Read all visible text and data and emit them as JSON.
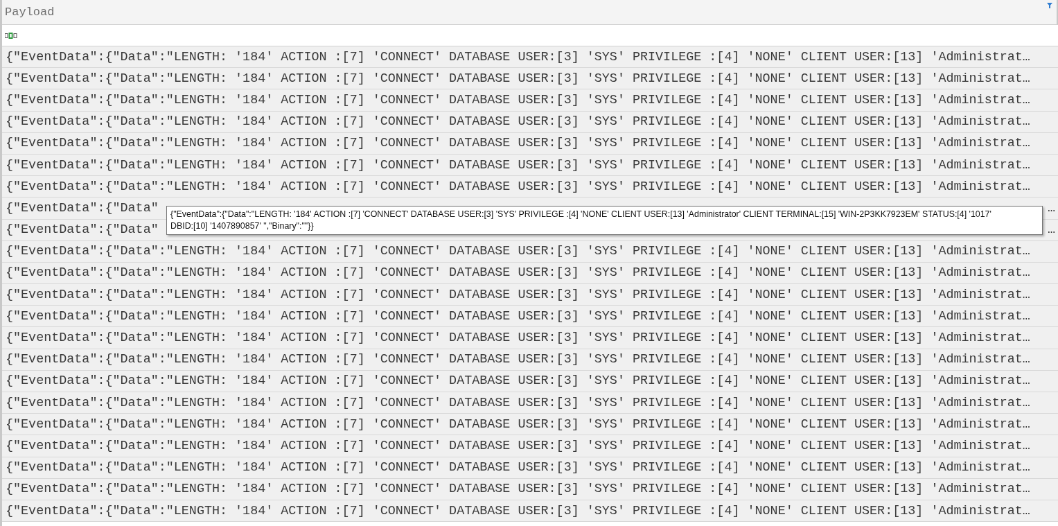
{
  "column": {
    "header": "Payload",
    "filter_active": true
  },
  "rows": [
    {
      "text": "{\"EventData\":{\"Data\":\"LENGTH: '184' ACTION :[7] 'CONNECT' DATABASE USER:[3] 'SYS' PRIVILEGE :[4] 'NONE' CLIENT USER:[13] 'Administrat…"
    },
    {
      "text": "{\"EventData\":{\"Data\":\"LENGTH: '184' ACTION :[7] 'CONNECT' DATABASE USER:[3] 'SYS' PRIVILEGE :[4] 'NONE' CLIENT USER:[13] 'Administrat…"
    },
    {
      "text": "{\"EventData\":{\"Data\":\"LENGTH: '184' ACTION :[7] 'CONNECT' DATABASE USER:[3] 'SYS' PRIVILEGE :[4] 'NONE' CLIENT USER:[13] 'Administrat…"
    },
    {
      "text": "{\"EventData\":{\"Data\":\"LENGTH: '184' ACTION :[7] 'CONNECT' DATABASE USER:[3] 'SYS' PRIVILEGE :[4] 'NONE' CLIENT USER:[13] 'Administrat…"
    },
    {
      "text": "{\"EventData\":{\"Data\":\"LENGTH: '184' ACTION :[7] 'CONNECT' DATABASE USER:[3] 'SYS' PRIVILEGE :[4] 'NONE' CLIENT USER:[13] 'Administrat…"
    },
    {
      "text": "{\"EventData\":{\"Data\":\"LENGTH: '184' ACTION :[7] 'CONNECT' DATABASE USER:[3] 'SYS' PRIVILEGE :[4] 'NONE' CLIENT USER:[13] 'Administrat…"
    },
    {
      "text": "{\"EventData\":{\"Data\":\"LENGTH: '184' ACTION :[7] 'CONNECT' DATABASE USER:[3] 'SYS' PRIVILEGE :[4] 'NONE' CLIENT USER:[13] 'Administrat…"
    },
    {
      "text": "{\"EventData\":{\"Data\"",
      "tail": "…"
    },
    {
      "text": "{\"EventData\":{\"Data\"",
      "tail": "…"
    },
    {
      "text": "{\"EventData\":{\"Data\":\"LENGTH: '184' ACTION :[7] 'CONNECT' DATABASE USER:[3] 'SYS' PRIVILEGE :[4] 'NONE' CLIENT USER:[13] 'Administrat…"
    },
    {
      "text": "{\"EventData\":{\"Data\":\"LENGTH: '184' ACTION :[7] 'CONNECT' DATABASE USER:[3] 'SYS' PRIVILEGE :[4] 'NONE' CLIENT USER:[13] 'Administrat…"
    },
    {
      "text": "{\"EventData\":{\"Data\":\"LENGTH: '184' ACTION :[7] 'CONNECT' DATABASE USER:[3] 'SYS' PRIVILEGE :[4] 'NONE' CLIENT USER:[13] 'Administrat…"
    },
    {
      "text": "{\"EventData\":{\"Data\":\"LENGTH: '184' ACTION :[7] 'CONNECT' DATABASE USER:[3] 'SYS' PRIVILEGE :[4] 'NONE' CLIENT USER:[13] 'Administrat…"
    },
    {
      "text": "{\"EventData\":{\"Data\":\"LENGTH: '184' ACTION :[7] 'CONNECT' DATABASE USER:[3] 'SYS' PRIVILEGE :[4] 'NONE' CLIENT USER:[13] 'Administrat…"
    },
    {
      "text": "{\"EventData\":{\"Data\":\"LENGTH: '184' ACTION :[7] 'CONNECT' DATABASE USER:[3] 'SYS' PRIVILEGE :[4] 'NONE' CLIENT USER:[13] 'Administrat…"
    },
    {
      "text": "{\"EventData\":{\"Data\":\"LENGTH: '184' ACTION :[7] 'CONNECT' DATABASE USER:[3] 'SYS' PRIVILEGE :[4] 'NONE' CLIENT USER:[13] 'Administrat…"
    },
    {
      "text": "{\"EventData\":{\"Data\":\"LENGTH: '184' ACTION :[7] 'CONNECT' DATABASE USER:[3] 'SYS' PRIVILEGE :[4] 'NONE' CLIENT USER:[13] 'Administrat…"
    },
    {
      "text": "{\"EventData\":{\"Data\":\"LENGTH: '184' ACTION :[7] 'CONNECT' DATABASE USER:[3] 'SYS' PRIVILEGE :[4] 'NONE' CLIENT USER:[13] 'Administrat…"
    },
    {
      "text": "{\"EventData\":{\"Data\":\"LENGTH: '184' ACTION :[7] 'CONNECT' DATABASE USER:[3] 'SYS' PRIVILEGE :[4] 'NONE' CLIENT USER:[13] 'Administrat…"
    },
    {
      "text": "{\"EventData\":{\"Data\":\"LENGTH: '184' ACTION :[7] 'CONNECT' DATABASE USER:[3] 'SYS' PRIVILEGE :[4] 'NONE' CLIENT USER:[13] 'Administrat…"
    },
    {
      "text": "{\"EventData\":{\"Data\":\"LENGTH: '184' ACTION :[7] 'CONNECT' DATABASE USER:[3] 'SYS' PRIVILEGE :[4] 'NONE' CLIENT USER:[13] 'Administrat…"
    },
    {
      "text": "{\"EventData\":{\"Data\":\"LENGTH: '184' ACTION :[7] 'CONNECT' DATABASE USER:[3] 'SYS' PRIVILEGE :[4] 'NONE' CLIENT USER:[13] 'Administrat…"
    }
  ],
  "tooltip": {
    "lines": [
      "{\"EventData\":{\"Data\":\"LENGTH: '184' ACTION :[7] 'CONNECT' DATABASE USER:[3] 'SYS' PRIVILEGE :[4] 'NONE' CLIENT USER:[13] 'Administrator' CLIENT TERMINAL:[15] 'WIN-2P3KK7923EM' STATUS:[4] '1017'",
      "DBID:[10] '1407890857' \",\"Binary\":\"\"}}"
    ]
  }
}
